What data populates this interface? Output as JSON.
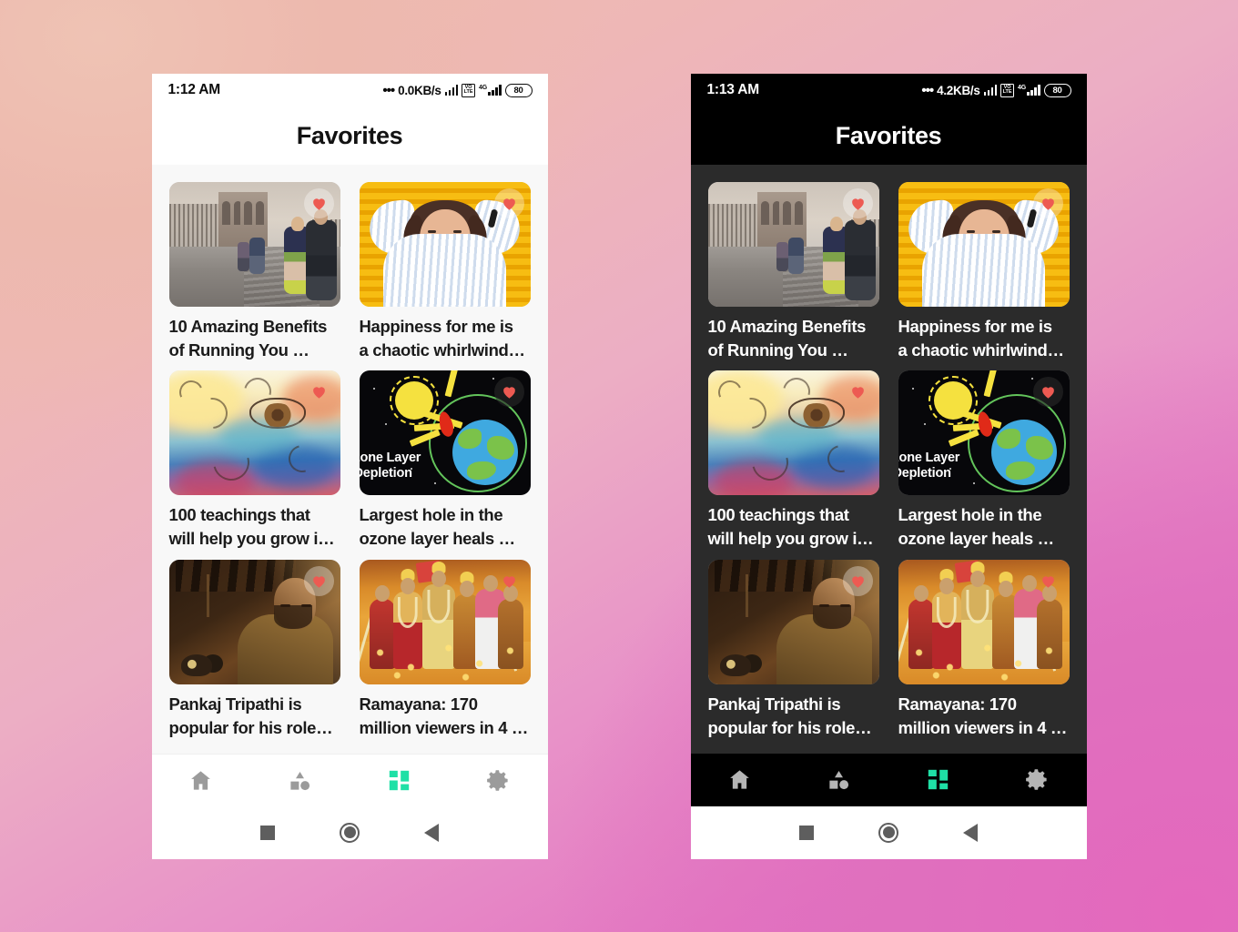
{
  "background": {
    "gradient_start": "#EDBCAE",
    "gradient_end": "#E56DBE"
  },
  "accent_color": "#1FE0A6",
  "heart_color": "#ED5A52",
  "phones": [
    {
      "theme": "light",
      "status_bar": {
        "time": "1:12 AM",
        "dots": "•••",
        "network_speed": "0.0KB/s",
        "volte_label_top": "VO",
        "volte_label_bottom": "LTE",
        "network_type": "4G",
        "battery": "80"
      },
      "app_bar": {
        "title": "Favorites"
      },
      "cards": [
        {
          "title": "10 Amazing Benefits\nof Running You …",
          "art": "art-bridge",
          "heart_style": "light-pill",
          "favorited": true
        },
        {
          "title": "Happiness for me is\na chaotic whirlwind…",
          "art": "art-happy",
          "heart_style": "light-pill",
          "favorited": true
        },
        {
          "title": "100 teachings that\nwill help you grow i…",
          "art": "art-eye",
          "heart_style": "bare",
          "favorited": true
        },
        {
          "title": "Largest hole in the\nozone layer heals …",
          "art": "art-ozone",
          "heart_style": "dark-pill",
          "favorited": true,
          "overlay_text": "zone Layer\nDepletion"
        },
        {
          "title": "Pankaj Tripathi is\npopular for his role…",
          "art": "art-pankaj",
          "heart_style": "light-pill",
          "favorited": true
        },
        {
          "title": "Ramayana: 170\nmillion viewers in 4 …",
          "art": "art-rama",
          "heart_style": "bare",
          "favorited": true
        }
      ],
      "bottom_nav": [
        {
          "icon": "home-icon",
          "label": "Home",
          "active": false
        },
        {
          "icon": "shapes-icon",
          "label": "Categories",
          "active": false
        },
        {
          "icon": "grid-dashboard-icon",
          "label": "Favorites",
          "active": true
        },
        {
          "icon": "gear-icon",
          "label": "Settings",
          "active": false
        }
      ],
      "system_bar": [
        {
          "icon": "recents-square-icon",
          "label": "Recents"
        },
        {
          "icon": "home-circle-icon",
          "label": "Home"
        },
        {
          "icon": "back-triangle-icon",
          "label": "Back"
        }
      ]
    },
    {
      "theme": "dark",
      "status_bar": {
        "time": "1:13 AM",
        "dots": "•••",
        "network_speed": "4.2KB/s",
        "volte_label_top": "VO",
        "volte_label_bottom": "LTE",
        "network_type": "4G",
        "battery": "80"
      },
      "app_bar": {
        "title": "Favorites"
      },
      "cards": [
        {
          "title": "10 Amazing Benefits\nof Running You …",
          "art": "art-bridge",
          "heart_style": "light-pill",
          "favorited": true
        },
        {
          "title": "Happiness for me is\na chaotic whirlwind…",
          "art": "art-happy",
          "heart_style": "light-pill",
          "favorited": true
        },
        {
          "title": "100 teachings that\nwill help you grow i…",
          "art": "art-eye",
          "heart_style": "bare",
          "favorited": true
        },
        {
          "title": "Largest hole in the\nozone layer heals …",
          "art": "art-ozone",
          "heart_style": "dark-pill",
          "favorited": true,
          "overlay_text": "zone Layer\nDepletion"
        },
        {
          "title": "Pankaj Tripathi is\npopular for his role…",
          "art": "art-pankaj",
          "heart_style": "light-pill",
          "favorited": true
        },
        {
          "title": "Ramayana: 170\nmillion viewers in 4 …",
          "art": "art-rama",
          "heart_style": "bare",
          "favorited": true
        }
      ],
      "bottom_nav": [
        {
          "icon": "home-icon",
          "label": "Home",
          "active": false
        },
        {
          "icon": "shapes-icon",
          "label": "Categories",
          "active": false
        },
        {
          "icon": "grid-dashboard-icon",
          "label": "Favorites",
          "active": true
        },
        {
          "icon": "gear-icon",
          "label": "Settings",
          "active": false
        }
      ],
      "system_bar": [
        {
          "icon": "recents-square-icon",
          "label": "Recents"
        },
        {
          "icon": "home-circle-icon",
          "label": "Home"
        },
        {
          "icon": "back-triangle-icon",
          "label": "Back"
        }
      ]
    }
  ]
}
